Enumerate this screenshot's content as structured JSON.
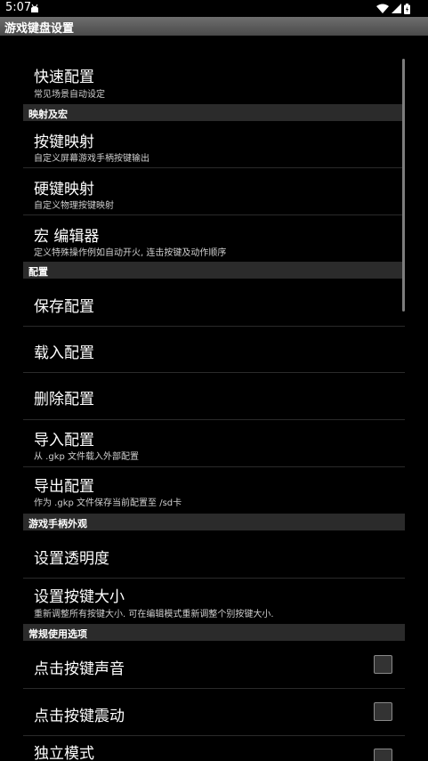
{
  "status": {
    "time": "5:07"
  },
  "title": "游戏键盘设置",
  "sections": {
    "quick": {
      "title": "快速配置",
      "sub": "常见场景自动设定"
    },
    "mapping_header": "映射及宏",
    "key_mapping": {
      "title": "按键映射",
      "sub": "自定义屏幕游戏手柄按键输出"
    },
    "hard_key_mapping": {
      "title": "硬键映射",
      "sub": "自定义物理按键映射"
    },
    "macro": {
      "title": "宏 编辑器",
      "sub": "定义特殊操作例如自动开火, 连击按键及动作顺序"
    },
    "config_header": "配置",
    "save": {
      "title": "保存配置"
    },
    "load": {
      "title": "载入配置"
    },
    "delete": {
      "title": "删除配置"
    },
    "import": {
      "title": "导入配置",
      "sub": "从 .gkp 文件载入外部配置"
    },
    "export": {
      "title": "导出配置",
      "sub": "作为 .gkp 文件保存当前配置至 /sd卡"
    },
    "gamepad_header": "游戏手柄外观",
    "opacity": {
      "title": "设置透明度"
    },
    "key_size": {
      "title": "设置按键大小",
      "sub": "重新调整所有按键大小. 可在编辑模式重新调整个别按键大小."
    },
    "general_header": "常规使用选项",
    "key_sound": {
      "title": "点击按键声音",
      "checked": false
    },
    "key_vibrate": {
      "title": "点击按键震动",
      "checked": false
    },
    "standalone": {
      "title": "独立模式",
      "checked": false
    }
  }
}
